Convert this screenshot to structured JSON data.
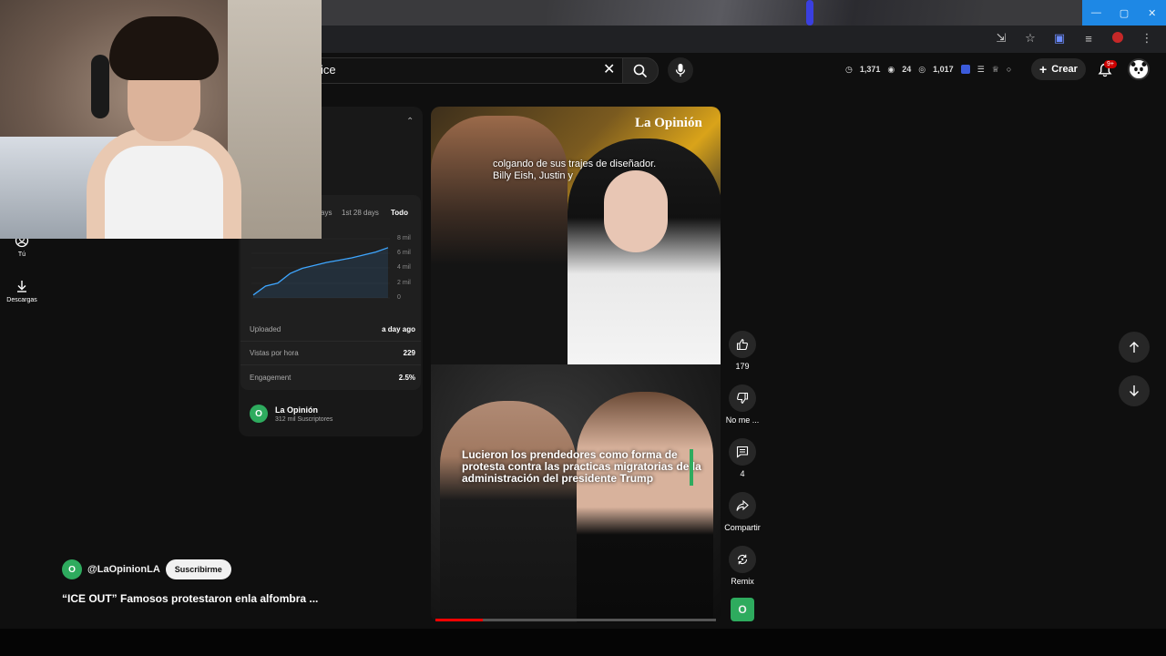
{
  "browser": {
    "window_controls": [
      "—",
      "▢",
      "✕"
    ],
    "toolbar_icons": [
      "install-icon",
      "star-icon",
      "extension-icon",
      "media-icon",
      "profile-icon",
      "menu-icon"
    ]
  },
  "header": {
    "search_value": "ice",
    "stats": {
      "views": "1,371",
      "watching": "24",
      "likes": "1,017"
    },
    "create_label": "Crear",
    "notification_count": "9+"
  },
  "sidebar": {
    "items": [
      {
        "label": "Tú",
        "icon": "user-circle-icon"
      },
      {
        "label": "Descargas",
        "icon": "download-icon"
      }
    ]
  },
  "analytics": {
    "periods": [
      "ays",
      "1st 28 days",
      "Todo"
    ],
    "active_period": "Todo",
    "chart_data": {
      "type": "line",
      "y_ticks": [
        "8 mil",
        "6 mil",
        "4 mil",
        "2 mil",
        "0"
      ],
      "ylim": [
        0,
        8000
      ],
      "values": [
        400,
        1600,
        2000,
        3300,
        4000,
        4400,
        4800,
        5100,
        5400,
        5800,
        6200,
        6800
      ],
      "color": "#3ea6ff"
    },
    "rows": [
      {
        "label": "Uploaded",
        "value": "a day ago"
      },
      {
        "label": "Vistas por hora",
        "value": "229"
      },
      {
        "label": "Engagement",
        "value": "2.5%"
      }
    ],
    "channel": {
      "name": "La Opinión",
      "subs": "312 mil Suscriptores",
      "logo_letter": "O"
    }
  },
  "video": {
    "watermark": "La Opinión",
    "caption_top": [
      "colgando de sus trajes de diseñador.",
      "Billy Eish, Justin y"
    ],
    "caption_bottom": "Lucieron los prendedores como forma de protesta contra las practicas migratorias de la administración del presidente Trump",
    "progress": 0.17
  },
  "actions": {
    "like_count": "179",
    "dislike_label": "No me ...",
    "comment_count": "4",
    "share_label": "Compartir",
    "remix_label": "Remix",
    "channel_logo_letter": "O"
  },
  "overlay": {
    "handle": "@LaOpinionLA",
    "subscribe_label": "Suscribirme",
    "title": "“ICE OUT” Famosos protestaron enla alfombra ...",
    "logo_letter": "O"
  },
  "colors": {
    "accent_green": "#2eab5e",
    "progress_red": "#ff0000",
    "badge_red": "#cc0000"
  }
}
